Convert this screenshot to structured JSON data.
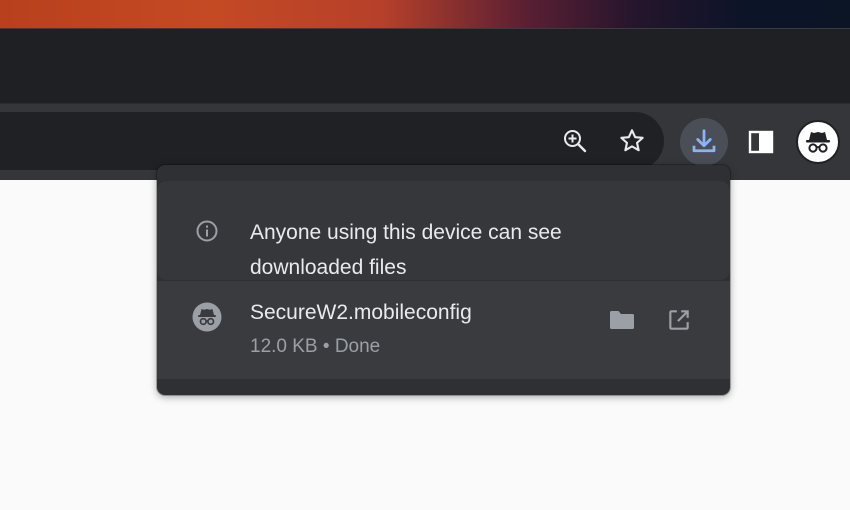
{
  "toolbar": {
    "zoom_icon": "zoom-in-icon",
    "bookmark_icon": "star-icon",
    "downloads_icon": "download-icon",
    "side_panel_icon": "side-panel-icon",
    "profile_icon": "incognito-icon"
  },
  "downloads_bubble": {
    "notice": {
      "icon": "info-icon",
      "text_line1": "Anyone using this device can see",
      "text_line2": "downloaded files"
    },
    "items": [
      {
        "icon": "incognito-icon",
        "filename": "SecureW2.mobileconfig",
        "status": "12.0 KB • Done",
        "actions": [
          "folder-icon",
          "open-external-icon"
        ]
      }
    ]
  },
  "colors": {
    "toolbar_bg": "#35363a",
    "bubble_bg": "#2f3033",
    "accent_download": "#8ab4f8",
    "text_primary": "#e8eaed",
    "text_secondary": "#9aa0a6"
  }
}
